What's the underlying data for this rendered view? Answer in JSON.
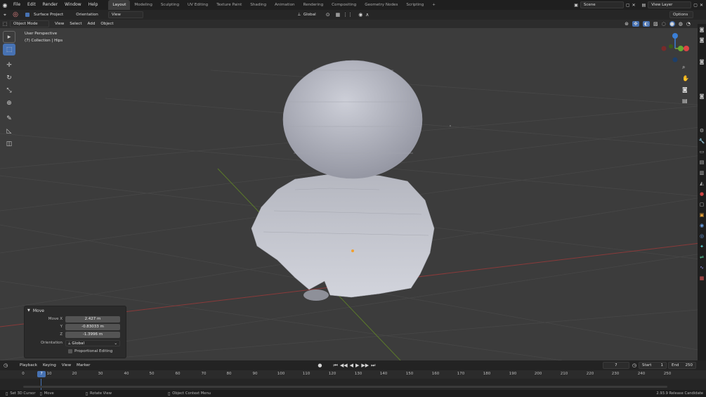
{
  "topbar": {
    "menus": [
      "File",
      "Edit",
      "Render",
      "Window",
      "Help"
    ],
    "workspaces": [
      "Layout",
      "Modeling",
      "Sculpting",
      "UV Editing",
      "Texture Paint",
      "Shading",
      "Animation",
      "Rendering",
      "Compositing",
      "Geometry Nodes",
      "Scripting"
    ],
    "active_workspace": "Layout",
    "add_tab": "+",
    "scene": "Scene",
    "view_layer": "View Layer"
  },
  "header2": {
    "surface_project": "Surface Project",
    "orientation_label": "Orientation",
    "orientation_value": "View",
    "transform_orientation": "Global",
    "options": "Options"
  },
  "header3": {
    "mode": "Object Mode",
    "menus": [
      "View",
      "Select",
      "Add",
      "Object"
    ]
  },
  "viewport": {
    "perspective": "User Perspective",
    "collection": "(7) Collection | Hips",
    "gizmo_axes": {
      "x": "X",
      "y": "Y",
      "z": "Z"
    }
  },
  "move_panel": {
    "title": "Move",
    "move_x_label": "Move X",
    "move_x": "2.427 m",
    "y_label": "Y",
    "y": "-0.83033 m",
    "z_label": "Z",
    "z": "-1.3996 m",
    "orientation_label": "Orientation",
    "orientation": "Global",
    "proportional": "Proportional Editing"
  },
  "timeline": {
    "menus": [
      "Playback",
      "Keying",
      "View",
      "Marker"
    ],
    "current_frame": "7",
    "start_label": "Start",
    "start": "1",
    "end_label": "End",
    "end": "250",
    "ticks": [
      "0",
      "10",
      "20",
      "30",
      "40",
      "50",
      "60",
      "70",
      "80",
      "90",
      "100",
      "110",
      "120",
      "130",
      "140",
      "150",
      "160",
      "170",
      "180",
      "190",
      "200",
      "210",
      "220",
      "230",
      "240",
      "250"
    ],
    "playhead": "7"
  },
  "status": {
    "set_cursor": "Set 3D Cursor",
    "move": "Move",
    "rotate": "Rotate View",
    "context": "Object Context Menu",
    "version": "2.93.9 Release Candidate"
  }
}
